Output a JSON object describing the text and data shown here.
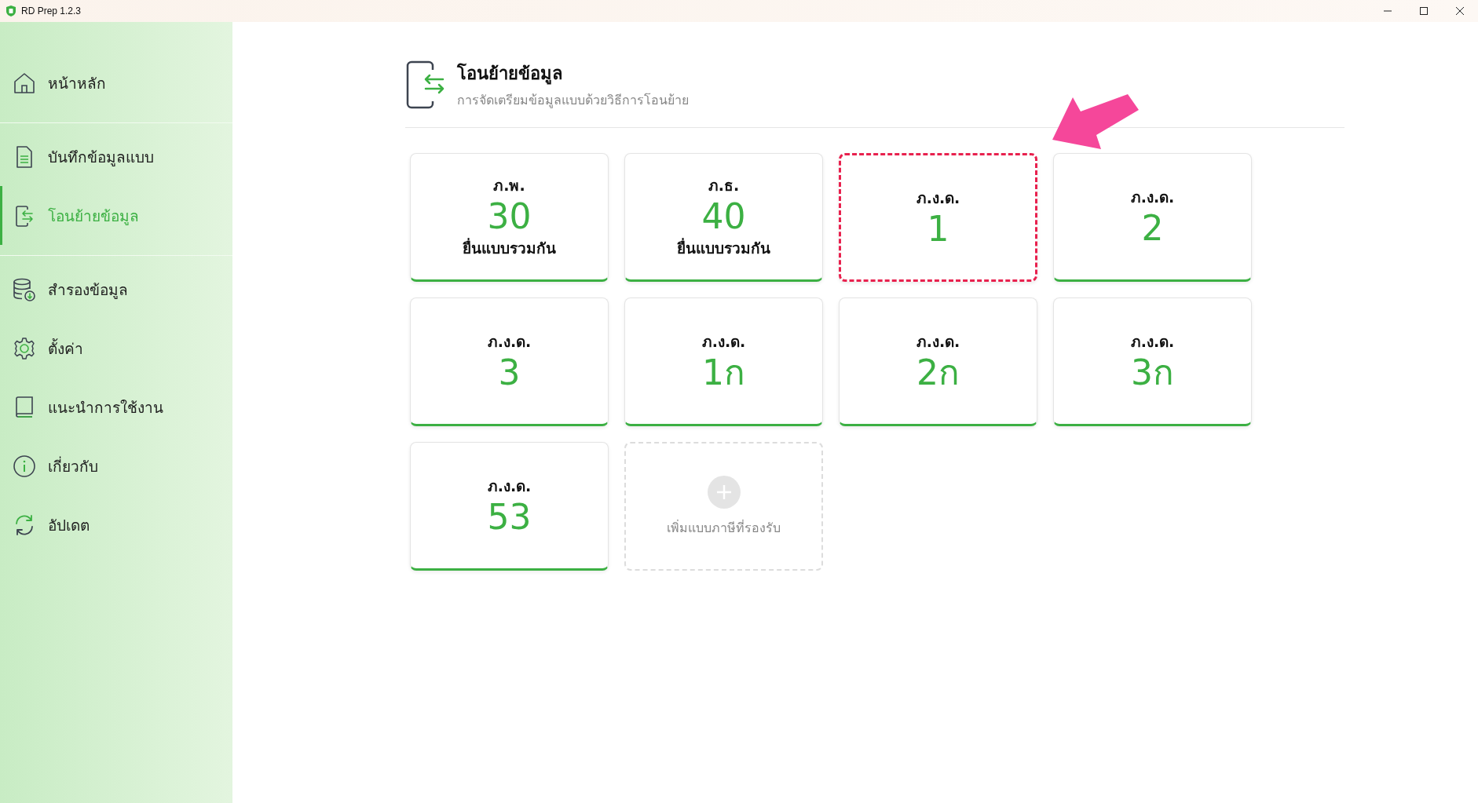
{
  "window": {
    "title": "RD Prep 1.2.3"
  },
  "sidebar": {
    "sections": [
      {
        "items": [
          {
            "label": "หน้าหลัก",
            "selected": false
          }
        ]
      },
      {
        "items": [
          {
            "label": "บันทึกข้อมูลแบบ",
            "selected": false
          },
          {
            "label": "โอนย้ายข้อมูล",
            "selected": true
          }
        ]
      },
      {
        "items": [
          {
            "label": "สำรองข้อมูล",
            "selected": false
          },
          {
            "label": "ตั้งค่า",
            "selected": false
          },
          {
            "label": "แนะนำการใช้งาน",
            "selected": false
          },
          {
            "label": "เกี่ยวกับ",
            "selected": false
          },
          {
            "label": "อัปเดต",
            "selected": false
          }
        ]
      }
    ]
  },
  "header": {
    "title": "โอนย้ายข้อมูล",
    "subtitle": "การจัดเตรียมข้อมูลแบบด้วยวิธีการโอนย้าย"
  },
  "cards": [
    {
      "label": "ภ.พ.",
      "number": "30",
      "note": "ยื่นแบบรวมกัน",
      "highlighted": false
    },
    {
      "label": "ภ.ธ.",
      "number": "40",
      "note": "ยื่นแบบรวมกัน",
      "highlighted": false
    },
    {
      "label": "ภ.ง.ด.",
      "number": "1",
      "highlighted": true
    },
    {
      "label": "ภ.ง.ด.",
      "number": "2",
      "highlighted": false
    },
    {
      "label": "ภ.ง.ด.",
      "number": "3",
      "highlighted": false
    },
    {
      "label": "ภ.ง.ด.",
      "number": "1ก",
      "highlighted": false
    },
    {
      "label": "ภ.ง.ด.",
      "number": "2ก",
      "highlighted": false
    },
    {
      "label": "ภ.ง.ด.",
      "number": "3ก",
      "highlighted": false
    },
    {
      "label": "ภ.ง.ด.",
      "number": "53",
      "highlighted": false
    }
  ],
  "add_card": {
    "label": "เพิ่มแบบภาษีที่รองรับ"
  }
}
